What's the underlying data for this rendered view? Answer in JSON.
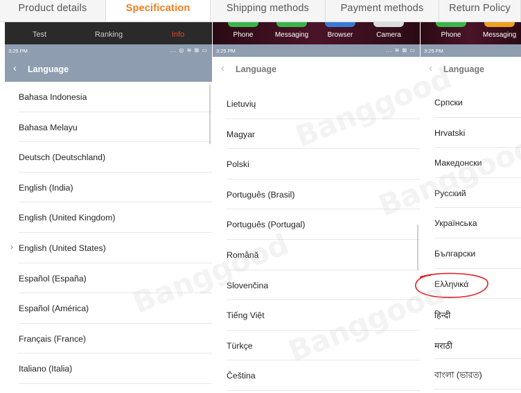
{
  "tabs": [
    {
      "label": "Product details",
      "active": false
    },
    {
      "label": "Specification",
      "active": true
    },
    {
      "label": "Shipping methods",
      "active": false
    },
    {
      "label": "Payment methods",
      "active": false
    },
    {
      "label": "Return Policy",
      "active": false
    }
  ],
  "accent_color": "#f07c1e",
  "highlight_color": "#e0472a",
  "header_color": "#8e9db0",
  "panels": [
    {
      "strip": [
        "Test",
        "Ranking",
        "Info"
      ],
      "time": "3:25 PM",
      "status_icons": "... ◎ ≋ ⊠ ▭",
      "back": "‹",
      "title": "Language",
      "items": [
        "Bahasa Indonesia",
        "Bahasa Melayu",
        "Deutsch (Deutschland)",
        "English (India)",
        "English (United Kingdom)",
        "English (United States)",
        "Español (España)",
        "Español (América)",
        "Français (France)",
        "Italiano (Italia)"
      ],
      "selected_index": 5,
      "selected_marker": "›"
    },
    {
      "strip": [
        "Phone",
        "Messaging",
        "Browser",
        "Camera"
      ],
      "time": "3:25 PM",
      "status_icons": "... ≋ ⊠ ▭",
      "back": "‹",
      "title": "Language",
      "items": [
        "Lietuvių",
        "Magyar",
        "Polski",
        "Português (Brasil)",
        "Português (Portugal)",
        "Română",
        "Slovenčina",
        "Tiếng Việt",
        "Türkçe",
        "Čeština"
      ]
    },
    {
      "strip": [
        "Phone",
        "Messaging"
      ],
      "time": "3:25 PM",
      "back": "‹",
      "title": "Language",
      "items": [
        "Српски",
        "Hrvatski",
        "Македонски",
        "Русский",
        "Українська",
        "Български",
        "Ελληνικά",
        "हिन्दी",
        "मराठी",
        "বাংলা (ভারত)"
      ],
      "circled_index": 6
    }
  ],
  "watermark": "Banggood"
}
